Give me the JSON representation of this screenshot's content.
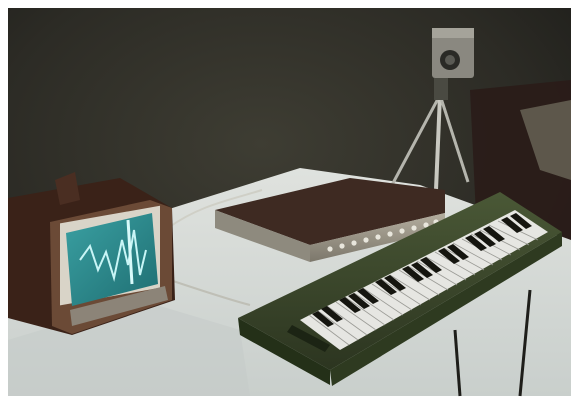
{
  "photo": {
    "alt": "",
    "colors": {
      "wall": "#2a2a24",
      "wall_light": "#3a3a32",
      "table": "#d8dcd8",
      "table_shadow": "#9ea8a6",
      "tv_body": "#4a2e20",
      "tv_screen": "#2a8a8c",
      "trace": "#bff0f2",
      "synth_top": "#3e2a22",
      "synth_front": "#9a9486",
      "keyboard_body": "#3e4a2e",
      "white_key": "#e8e8e6",
      "black_key": "#1a1a16",
      "tripod": "#b8b8b2",
      "camera": "#8a8880",
      "border": "#ffffff"
    }
  }
}
